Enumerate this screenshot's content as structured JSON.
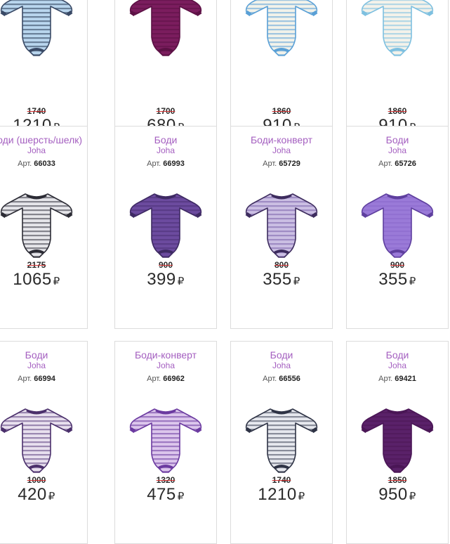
{
  "currency": "₽",
  "art_prefix": "Арт.",
  "rows": [
    {
      "cards": [
        {
          "title": "",
          "brand": "",
          "art": "",
          "old_price": "1740",
          "price": "1210",
          "colors": {
            "base": "#b9d6ee",
            "accent": "#2a3a55",
            "trim": "#3a4a66"
          }
        },
        {
          "title": "",
          "brand": "",
          "art": "",
          "old_price": "1700",
          "price": "680",
          "colors": {
            "base": "#7b1d5e",
            "accent": "#5c1145",
            "trim": "#5c1145"
          }
        },
        {
          "title": "",
          "brand": "",
          "art": "",
          "old_price": "1860",
          "price": "910",
          "colors": {
            "base": "#f2f2ea",
            "accent": "#5aa0d6",
            "trim": "#5aa0d6"
          }
        },
        {
          "title": "",
          "brand": "",
          "art": "",
          "old_price": "1860",
          "price": "910",
          "colors": {
            "base": "#f4f2ea",
            "accent": "#7ec0e0",
            "trim": "#7ec0e0"
          }
        }
      ]
    },
    {
      "cards": [
        {
          "title": "Боди (шерсть/шелк)",
          "brand": "Joha",
          "art": "66033",
          "old_price": "2175",
          "price": "1065",
          "colors": {
            "base": "#e6e6ea",
            "accent": "#33333d",
            "trim": "#2c2c35"
          }
        },
        {
          "title": "Боди",
          "brand": "Joha",
          "art": "66993",
          "old_price": "900",
          "price": "399",
          "colors": {
            "base": "#6c4b9f",
            "accent": "#4a3075",
            "trim": "#3e2a63"
          }
        },
        {
          "title": "Боди-конверт",
          "brand": "Joha",
          "art": "65729",
          "old_price": "800",
          "price": "355",
          "colors": {
            "base": "#cbbfe3",
            "accent": "#7a62aa",
            "trim": "#3d2c5e"
          }
        },
        {
          "title": "Боди",
          "brand": "Joha",
          "art": "65726",
          "old_price": "900",
          "price": "355",
          "colors": {
            "base": "#9a7ad8",
            "accent": "#8a68cb",
            "trim": "#5e3f9e"
          }
        }
      ]
    },
    {
      "cards": [
        {
          "title": "Боди",
          "brand": "Joha",
          "art": "66994",
          "old_price": "1000",
          "price": "420",
          "colors": {
            "base": "#e8e0ee",
            "accent": "#5b3f7f",
            "trim": "#4a2f6b"
          }
        },
        {
          "title": "Боди-конверт",
          "brand": "Joha",
          "art": "66962",
          "old_price": "1320",
          "price": "475",
          "colors": {
            "base": "#dcc6ec",
            "accent": "#6b3aa0",
            "trim": "#6b3aa0"
          }
        },
        {
          "title": "Боди",
          "brand": "Joha",
          "art": "66556",
          "old_price": "1740",
          "price": "1210",
          "colors": {
            "base": "#e6e8ee",
            "accent": "#3c4256",
            "trim": "#2e3345"
          }
        },
        {
          "title": "Боди",
          "brand": "Joha",
          "art": "69421",
          "old_price": "1850",
          "price": "950",
          "colors": {
            "base": "#5a2169",
            "accent": "#4a1656",
            "trim": "#4a1656"
          }
        }
      ]
    }
  ]
}
